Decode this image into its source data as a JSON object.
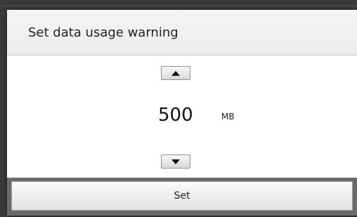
{
  "dialog": {
    "title": "Set data usage warning",
    "value": "500",
    "unit": "MB",
    "increment_icon": "triangle-up-icon",
    "decrement_icon": "triangle-down-icon",
    "set_label": "Set"
  },
  "colors": {
    "backdrop": "#3a3a3a",
    "dialog_background": "#fafafa",
    "footer": "#6a6a6a"
  }
}
